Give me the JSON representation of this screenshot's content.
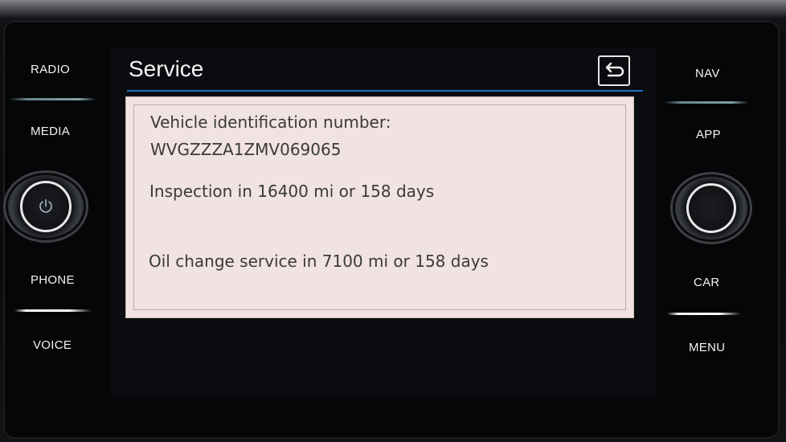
{
  "left_buttons": {
    "radio": "RADIO",
    "media": "MEDIA",
    "phone": "PHONE",
    "voice": "VOICE"
  },
  "right_buttons": {
    "nav": "NAV",
    "app": "APP",
    "car": "CAR",
    "menu": "MENU"
  },
  "header": {
    "title": "Service",
    "back_icon": "back-arrow-icon",
    "accent_color": "#1f6fc0"
  },
  "service_info": {
    "vin_label": "Vehicle identification number:",
    "vin_value": "WVGZZZA1ZMV069065",
    "inspection": "Inspection in 16400 mi or 158 days",
    "oil_change": "Oil change service in 7100 mi or 158 days"
  },
  "icons": {
    "power": "power-icon"
  },
  "colors": {
    "panel_background": "#f1e3e1",
    "text": "#3a3a3a"
  }
}
